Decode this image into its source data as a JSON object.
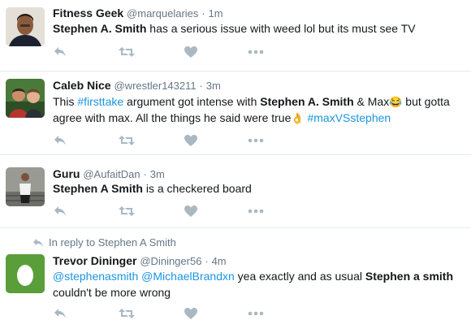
{
  "tweets": [
    {
      "name": "Fitness Geek",
      "handle": "@marquelaries",
      "separator": "·",
      "time": "1m",
      "text": {
        "highlight": "Stephen A. Smith",
        "rest": " has a serious issue with weed lol but its must see TV"
      }
    },
    {
      "name": "Caleb Nice",
      "handle": "@wrestler143211",
      "separator": "·",
      "time": "3m",
      "text": {
        "p1": "This ",
        "hashtag1": "#firsttake",
        "p2": " argument got intense with ",
        "highlight": "Stephen A. Smith",
        "p3": " & Max",
        "emoji1": "😂",
        "p4": " but gotta agree with max. All the things he said were true",
        "emoji2": "👌",
        "p5": " ",
        "hashtag2": "#maxVSstephen"
      }
    },
    {
      "name": "Guru",
      "handle": "@AufaitDan",
      "separator": "·",
      "time": "3m",
      "text": {
        "highlight": "Stephen A Smith",
        "rest": " is a checkered board"
      }
    },
    {
      "reply_context": "In reply to Stephen A Smith",
      "name": "Trevor Dininger",
      "handle": "@Dininger56",
      "separator": "·",
      "time": "4m",
      "text": {
        "mention1": "@stephenasmith",
        "p1": " ",
        "mention2": "@MichaelBrandxn",
        "p2": " yea exactly and as usual ",
        "highlight": "Stephen a smith",
        "p3": " couldn't  be more wrong"
      }
    }
  ],
  "action_icons": [
    "reply-icon",
    "retweet-icon",
    "like-icon",
    "more-icon"
  ],
  "colors": {
    "text": "#14171a",
    "secondary": "#657786",
    "link": "#1b95e0",
    "icon": "#aab8c2",
    "divider": "#e6ecf0",
    "egg_avatar": "#5a9e3a"
  }
}
